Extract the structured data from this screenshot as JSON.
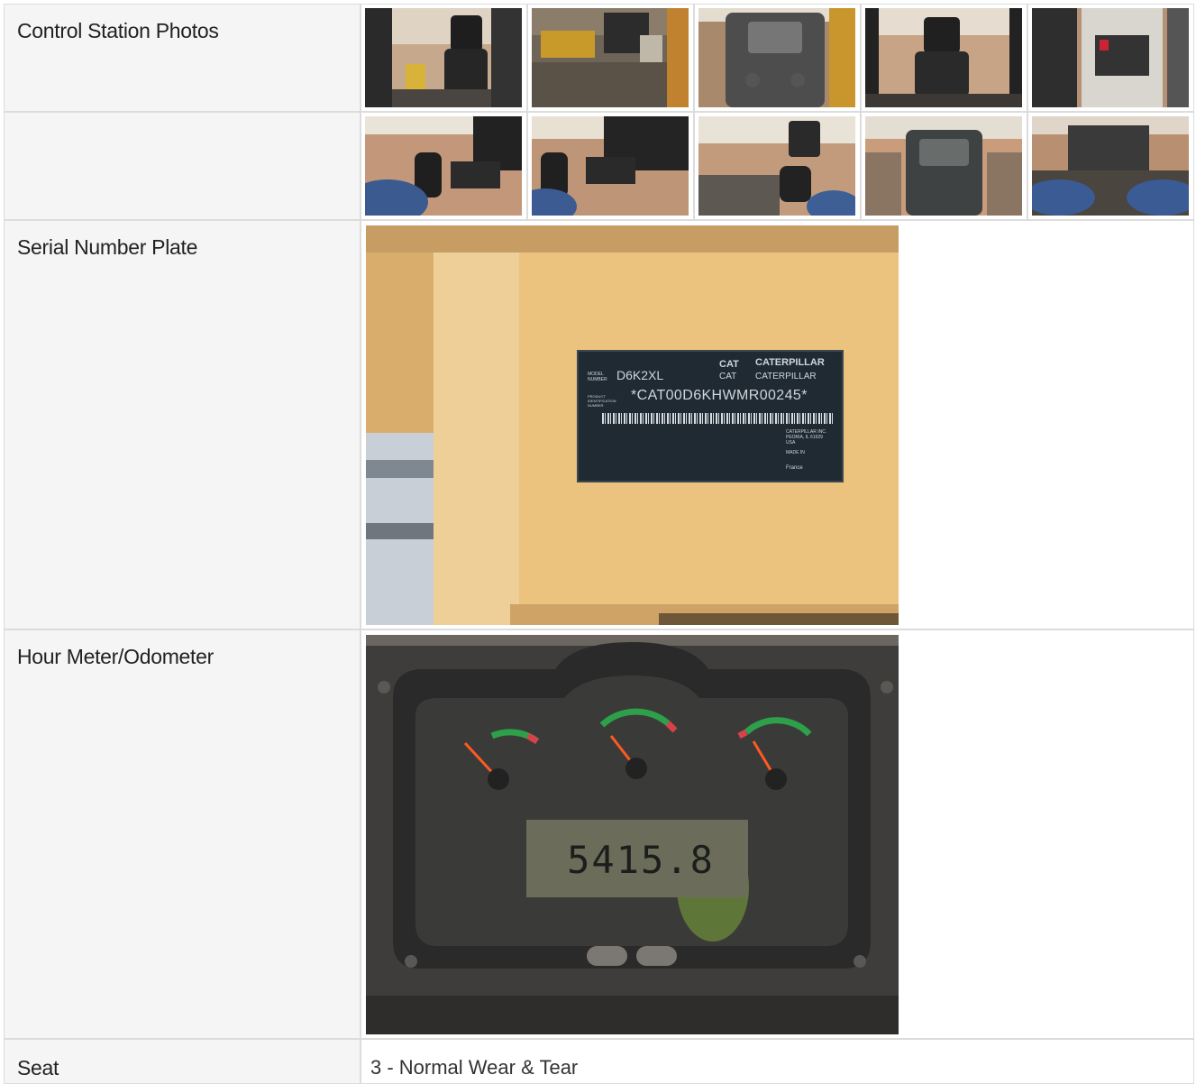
{
  "rows": {
    "control_station": {
      "label": "Control Station Photos"
    },
    "serial_plate": {
      "label": "Serial Number Plate",
      "plate": {
        "model_label": "MODEL NUMBER",
        "model": "D6K2XL",
        "pin_label": "PRODUCT IDENTIFICATION NUMBER",
        "pin": "*CAT00D6KHWMR00245*",
        "brand_cat": "CAT",
        "brand_caterpillar": "CATERPILLAR",
        "maker_1": "CATERPILLAR INC.",
        "maker_2": "PEORIA, IL 61629",
        "maker_3": "USA",
        "made_in": "MADE IN",
        "country": "France"
      }
    },
    "hour_meter": {
      "label": "Hour Meter/Odometer",
      "reading": "5415.8"
    },
    "seat": {
      "label": "Seat",
      "value": "3 - Normal Wear & Tear"
    }
  }
}
